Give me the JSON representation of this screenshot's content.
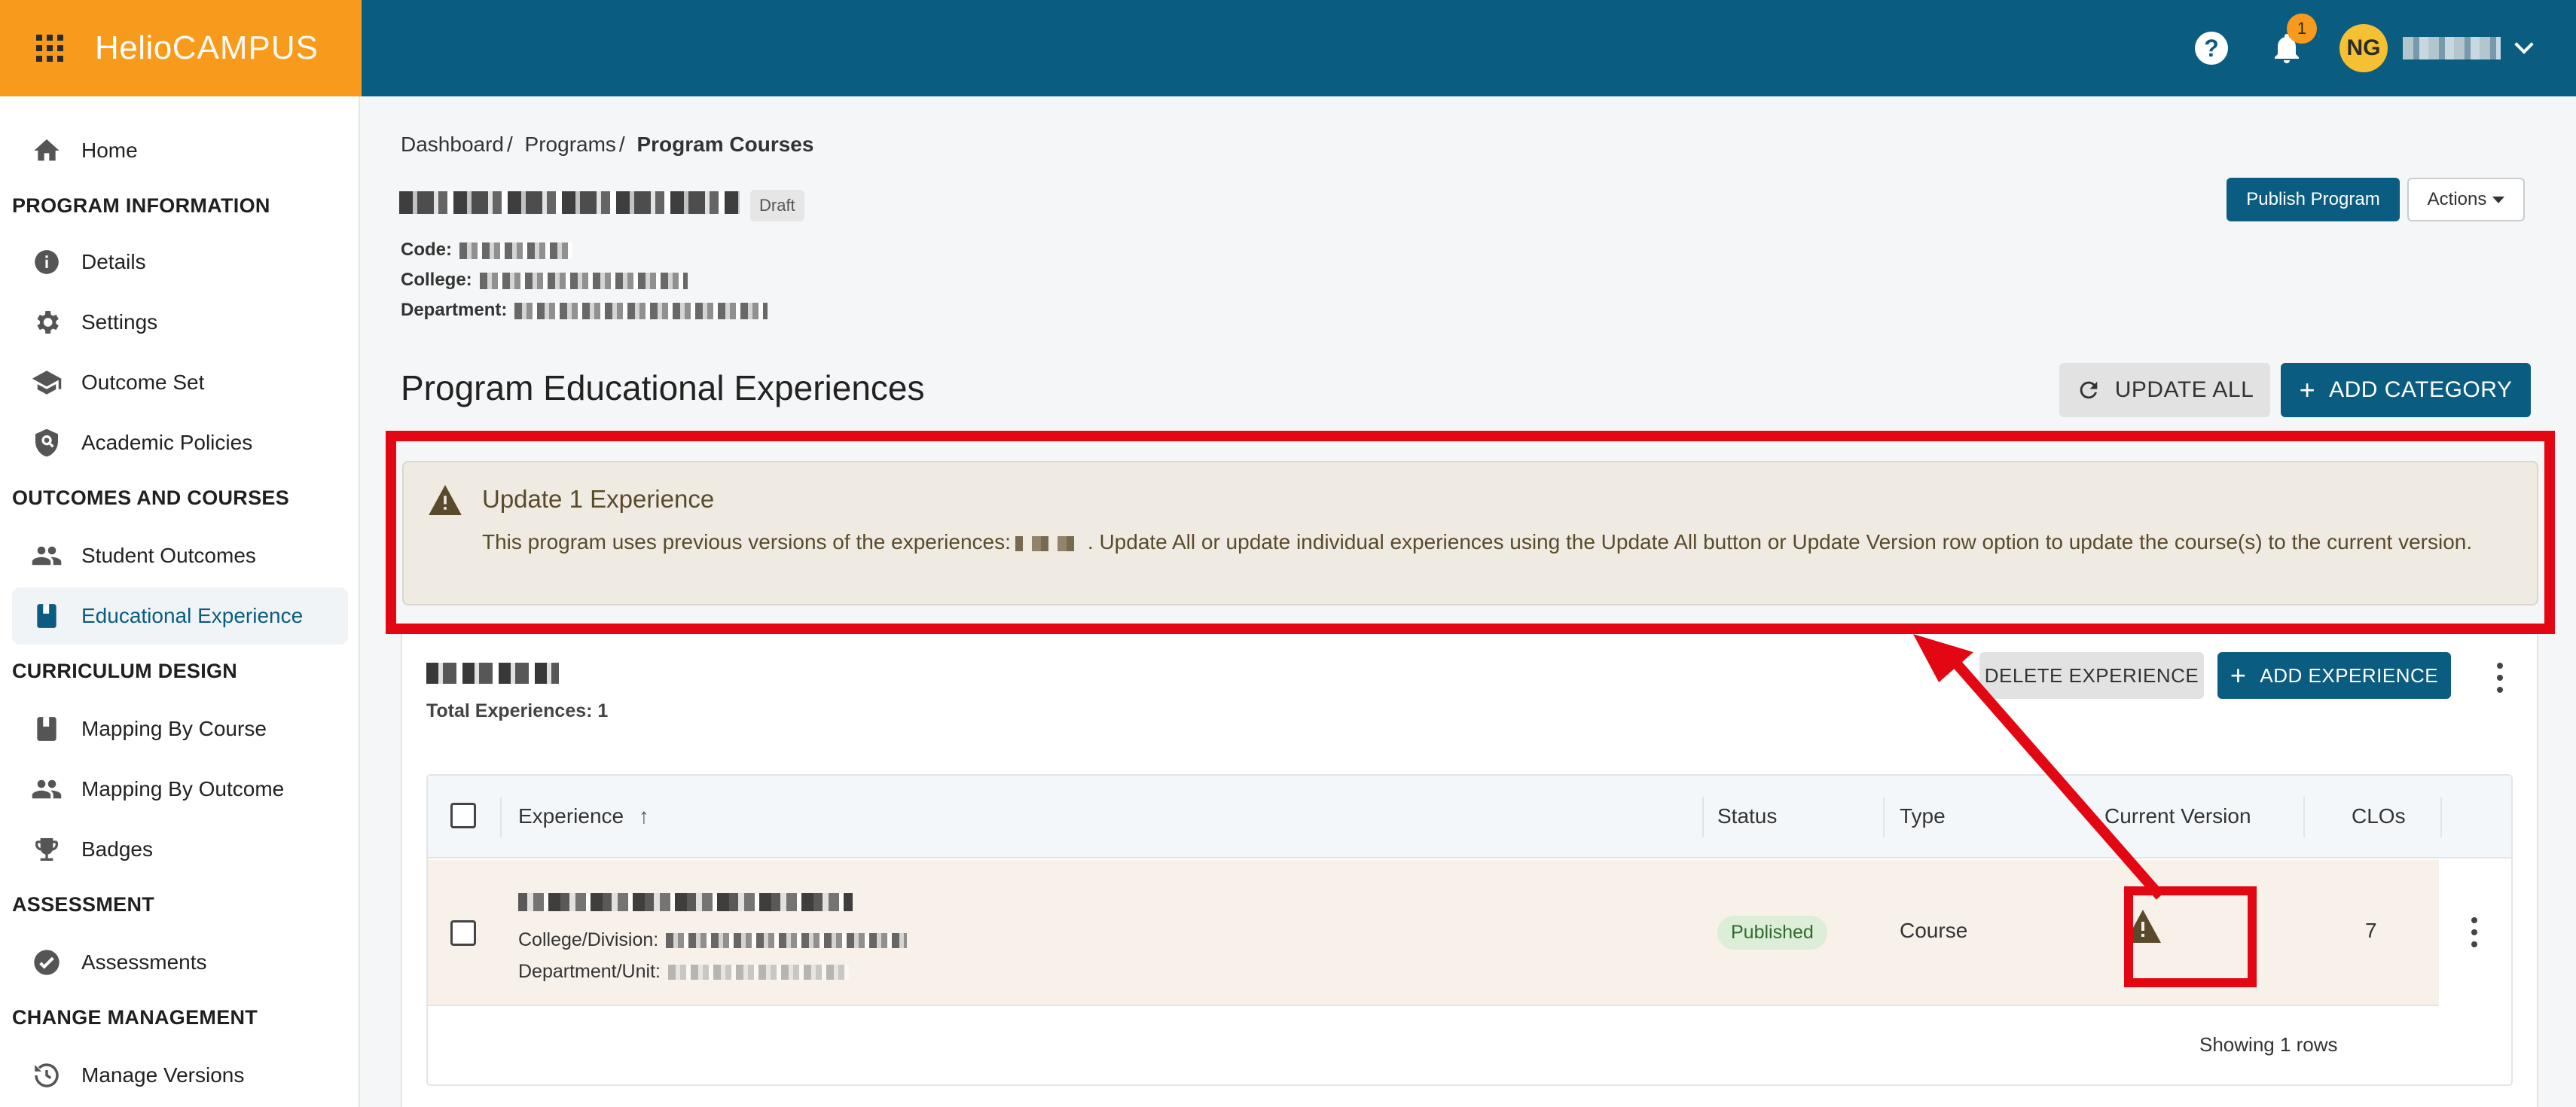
{
  "header": {
    "logo_main": "Helio",
    "logo_sub": "CAMPUS",
    "notifications_count": "1",
    "user_initials": "NG"
  },
  "sidebar": {
    "items": [
      {
        "label": "Home",
        "icon": "home-icon"
      },
      {
        "section": "PROGRAM INFORMATION"
      },
      {
        "label": "Details",
        "icon": "info-icon"
      },
      {
        "label": "Settings",
        "icon": "gear-icon"
      },
      {
        "label": "Outcome Set",
        "icon": "graduation-cap-icon"
      },
      {
        "label": "Academic Policies",
        "icon": "shield-search-icon"
      },
      {
        "section": "OUTCOMES AND COURSES"
      },
      {
        "label": "Student Outcomes",
        "icon": "people-icon"
      },
      {
        "label": "Educational Experience",
        "icon": "book-icon",
        "active": true
      },
      {
        "section": "CURRICULUM DESIGN"
      },
      {
        "label": "Mapping By Course",
        "icon": "book-closed-icon"
      },
      {
        "label": "Mapping By Outcome",
        "icon": "people-icon"
      },
      {
        "label": "Badges",
        "icon": "trophy-icon"
      },
      {
        "section": "ASSESSMENT"
      },
      {
        "label": "Assessments",
        "icon": "check-circle-icon"
      },
      {
        "section": "CHANGE MANAGEMENT"
      },
      {
        "label": "Manage Versions",
        "icon": "history-icon"
      }
    ]
  },
  "breadcrumb": {
    "dashboard": "Dashboard",
    "programs": "Programs",
    "current": "Program Courses",
    "separator": "/"
  },
  "program": {
    "status_badge": "Draft",
    "code_label": "Code:",
    "college_label": "College:",
    "department_label": "Department:"
  },
  "toolbar": {
    "publish": "Publish Program",
    "actions": "Actions"
  },
  "page_title": "Program Educational Experiences",
  "buttons": {
    "update_all": "UPDATE ALL",
    "add_category": "ADD CATEGORY",
    "delete_experience": "DELETE EXPERIENCE",
    "add_experience": "ADD EXPERIENCE"
  },
  "alert": {
    "title": "Update 1 Experience",
    "body_before": "This program uses previous versions of the experiences:",
    "body_after": ". Update All or update individual experiences using the Update All button or Update Version row option to update the course(s) to the current version."
  },
  "category": {
    "total_experiences": "Total Experiences: 1"
  },
  "table": {
    "columns": {
      "experience": "Experience",
      "status": "Status",
      "type": "Type",
      "current_version": "Current Version",
      "clos": "CLOs"
    },
    "rows": [
      {
        "college_label": "College/Division:",
        "department_label": "Department/Unit:",
        "status": "Published",
        "type": "Course",
        "clos": "7"
      }
    ],
    "footer": "Showing 1 rows"
  },
  "colors": {
    "header": "#0a5c80",
    "brand": "#f89b1c",
    "highlight": "#e30613",
    "alert_bg": "#efebe3"
  }
}
